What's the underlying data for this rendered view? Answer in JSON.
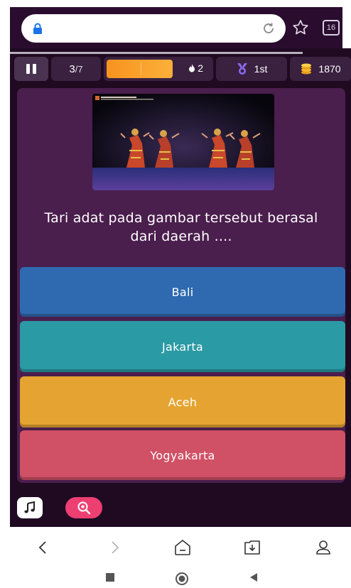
{
  "browser": {
    "url": "",
    "tab_count": "16",
    "icons": [
      "lock-icon",
      "reload-icon",
      "star-icon",
      "tabs-icon"
    ]
  },
  "quiz": {
    "question_current": "3",
    "question_total": "/7",
    "streak_count": "2",
    "streak_level": 0.64,
    "rank": "1st",
    "coins": "1870",
    "question_text": "Tari adat pada gambar tersebut berasal dari daerah ....",
    "options": [
      {
        "label": "Bali",
        "color": "#2f6ab0"
      },
      {
        "label": "Jakarta",
        "color": "#2a9aa4"
      },
      {
        "label": "Aceh",
        "color": "#e5a431"
      },
      {
        "label": "Yogyakarta",
        "color": "#d05065"
      }
    ],
    "tools": [
      "music-icon",
      "zoom-in-icon"
    ]
  },
  "browser_nav": [
    "back-icon",
    "forward-icon",
    "home-icon",
    "download-icon",
    "profile-icon"
  ],
  "system_nav": [
    "recents-icon",
    "home-circle-icon",
    "back-triangle-icon"
  ],
  "colors": {
    "app_background": "#1f0a22",
    "card_background": "#4a1e4d",
    "streak_gradient_start": "#f7931e",
    "streak_gradient_end": "#fbb03b",
    "zoom_accent": "#ee3f72"
  }
}
